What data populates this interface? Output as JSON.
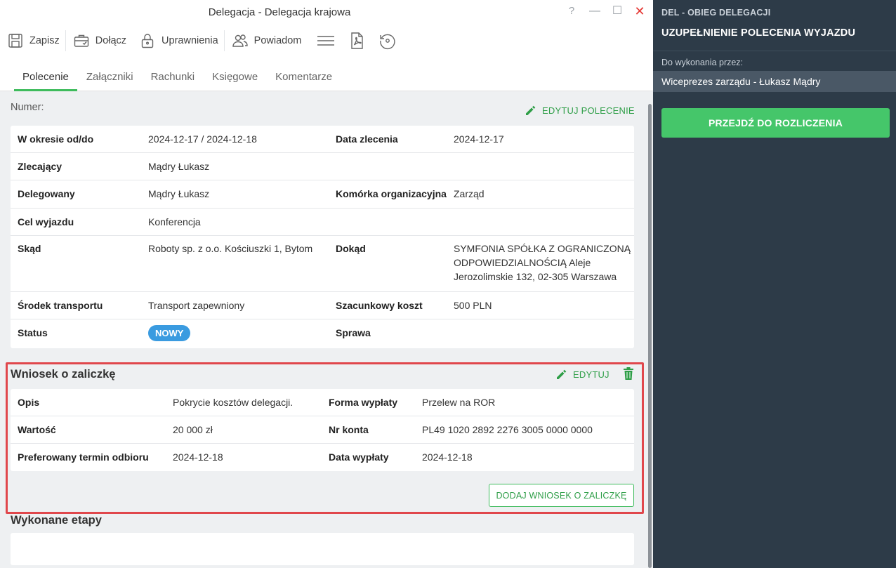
{
  "window": {
    "title": "Delegacja - Delegacja krajowa",
    "help": "?",
    "minimize": "—",
    "maximize": "☐",
    "close": "✕"
  },
  "toolbar": {
    "save": "Zapisz",
    "attach": "Dołącz",
    "permissions": "Uprawnienia",
    "notify": "Powiadom",
    "icons": [
      "menu-icon",
      "pdf-icon",
      "history-icon"
    ]
  },
  "tabs": [
    {
      "label": "Polecenie",
      "active": true
    },
    {
      "label": "Załączniki",
      "active": false
    },
    {
      "label": "Rachunki",
      "active": false
    },
    {
      "label": "Księgowe",
      "active": false
    },
    {
      "label": "Komentarze",
      "active": false
    }
  ],
  "order": {
    "number_label": "Numer:",
    "edit_label": "EDYTUJ POLECENIE",
    "fields": {
      "period_label": "W okresie od/do",
      "period_value": "2024-12-17 / 2024-12-18",
      "order_date_label": "Data zlecenia",
      "order_date_value": "2024-12-17",
      "orderer_label": "Zlecający",
      "orderer_value": "Mądry Łukasz",
      "delegate_label": "Delegowany",
      "delegate_value": "Mądry Łukasz",
      "unit_label": "Komórka organizacyjna",
      "unit_value": "Zarząd",
      "purpose_label": "Cel wyjazdu",
      "purpose_value": "Konferencja",
      "from_label": "Skąd",
      "from_value": "Roboty sp. z o.o. Kościuszki 1, Bytom",
      "to_label": "Dokąd",
      "to_value_line1": "SYMFONIA SPÓŁKA Z OGRANICZONĄ",
      "to_value_line2": "ODPOWIEDZIALNOŚCIĄ Aleje",
      "to_value_line3": "Jerozolimskie 132, 02-305 Warszawa",
      "transport_label": "Środek transportu",
      "transport_value": "Transport zapewniony",
      "cost_label": "Szacunkowy koszt",
      "cost_value": "500 PLN",
      "status_label": "Status",
      "status_value": "NOWY",
      "case_label": "Sprawa",
      "case_value": ""
    }
  },
  "advance": {
    "title": "Wniosek o zaliczkę",
    "edit_label": "EDYTUJ",
    "fields": {
      "desc_label": "Opis",
      "desc_value": "Pokrycie kosztów delegacji.",
      "payment_form_label": "Forma wypłaty",
      "payment_form_value": "Przelew na ROR",
      "amount_label": "Wartość",
      "amount_value": "20 000 zł",
      "account_label": "Nr konta",
      "account_value": "PL49 1020 2892 2276 3005 0000 0000",
      "preferred_date_label": "Preferowany termin odbioru",
      "preferred_date_value": "2024-12-18",
      "payout_date_label": "Data wypłaty",
      "payout_date_value": "2024-12-18"
    },
    "add_button": "DODAJ WNIOSEK O ZALICZKĘ"
  },
  "stages": {
    "title": "Wykonane etapy"
  },
  "side": {
    "workflow": "DEL - OBIEG DELEGACJI",
    "step_title": "UZUPEŁNIENIE POLECENIA WYJAZDU",
    "assigned_label": "Do wykonania przez:",
    "assignee": "Wiceprezes zarządu - Łukasz Mądry",
    "action_button": "PRZEJDŹ DO ROZLICZENIA"
  },
  "colors": {
    "accent_green": "#3dbb5c",
    "side_bg": "#2d3b48",
    "status_blue": "#3a9be0",
    "highlight_red": "#e0474c"
  }
}
